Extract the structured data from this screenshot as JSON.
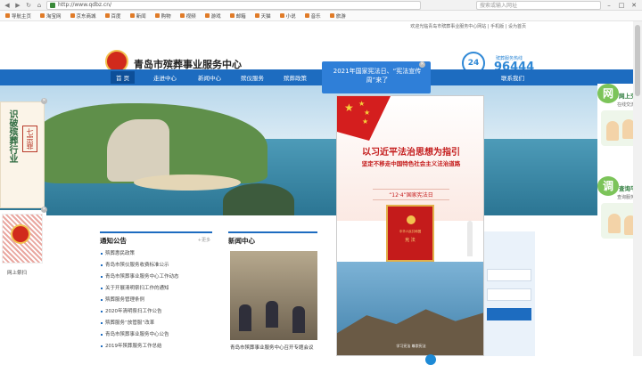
{
  "browser": {
    "url": "http://www.qdbz.cn/",
    "search_placeholder": "搜索或输入网址"
  },
  "bookmarks": [
    "导航主页",
    "淘宝网",
    "京东商城",
    "百度",
    "新闻",
    "购物",
    "视频",
    "游戏",
    "邮箱",
    "天猫",
    "小说",
    "音乐",
    "旅游"
  ],
  "header": {
    "top_note": "欢迎光临青岛市殡葬事业服务中心网站 | 手机版 | 设为首页",
    "site_title": "青岛市殡葬事业服务中心",
    "hotline_label": "殡葬服务热线",
    "hotline_number": "96444",
    "hotline_badge": "24"
  },
  "nav": {
    "items": [
      "首 页",
      "走进中心",
      "新闻中心",
      "殡仪服务",
      "殡葬政策",
      "联系我们"
    ]
  },
  "left_float": {
    "calligraphy": "识破殡葬行业",
    "stamp": "七宗罪",
    "qr_caption": "网上祭扫"
  },
  "notice": {
    "title": "通知公告",
    "more": "+更多",
    "items": [
      "殡葬惠民政策",
      "青岛市殡仪服务收费标准公示",
      "青岛市殡葬事业服务中心工作动态",
      "关于开展清明祭扫工作的通知",
      "殡葬服务管理条例",
      "2020年清明祭扫工作公告",
      "殡葬服务“放管服”改革",
      "青岛市殡葬事业服务中心公告",
      "2019年殡葬服务工作总结"
    ]
  },
  "news": {
    "title": "新闻中心",
    "caption": "青岛市殡葬事业服务中心召开专题会议"
  },
  "right_float": {
    "tag1": "网",
    "title1": "网上交流",
    "sub1": "在线交流",
    "tag2": "调",
    "title2": "查询平台",
    "sub2": "查询服务"
  },
  "popup": {
    "title": "2021年国家宪法日、“宪法宣传周”来了"
  },
  "poster": {
    "headline": "以习近平法治思想为指引",
    "subheadline": "坚定不移走中国特色社会主义法治道路",
    "tag": "“12·4”国家宪法日",
    "book_line1": "中华人民共和国",
    "book_line2": "宪 法",
    "footer": "学习宪法 尊崇宪法"
  },
  "colors": {
    "brand_blue": "#1d6cc0",
    "accent_red": "#c41b1b",
    "green": "#7cc45a"
  }
}
